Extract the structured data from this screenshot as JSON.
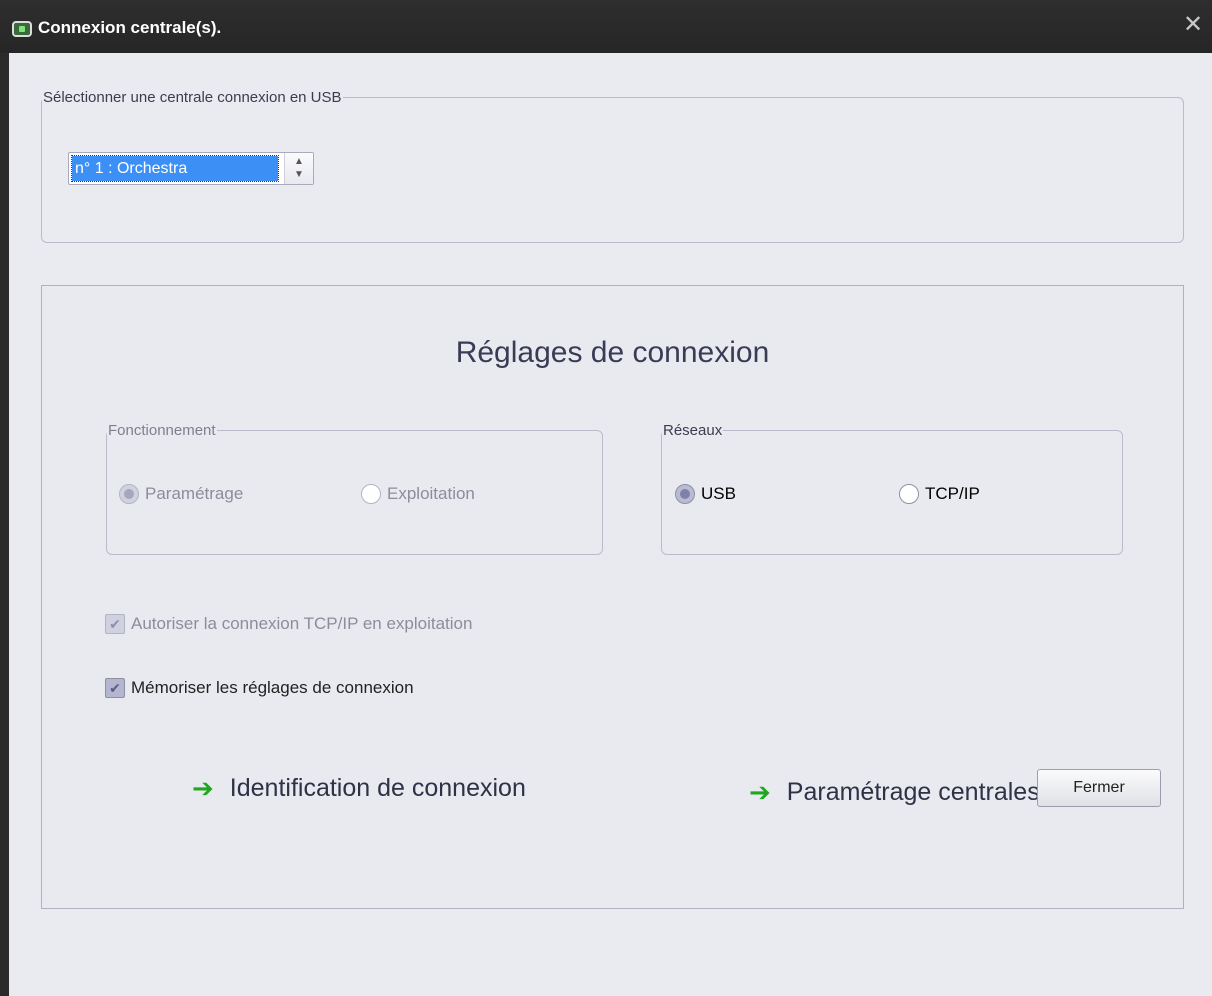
{
  "window": {
    "title": "Connexion centrale(s).",
    "close_glyph": "✕"
  },
  "usb_group": {
    "legend": "Sélectionner une centrale connexion en USB",
    "selected_value": "n° 1 : Orchestra",
    "arrows_glyph": "▲▼"
  },
  "settings": {
    "title": "Réglages de connexion",
    "fonctionnement": {
      "legend": "Fonctionnement",
      "options": [
        {
          "label": "Paramétrage",
          "selected": true,
          "disabled": true
        },
        {
          "label": "Exploitation",
          "selected": false,
          "disabled": true
        }
      ]
    },
    "reseaux": {
      "legend": "Réseaux",
      "options": [
        {
          "label": "USB",
          "selected": true
        },
        {
          "label": "TCP/IP",
          "selected": false
        }
      ]
    },
    "allow_tcp": {
      "label": "Autoriser la connexion TCP/IP en exploitation",
      "checked": true,
      "disabled": true
    },
    "remember": {
      "label": "Mémoriser les réglages de connexion",
      "checked": true
    },
    "links": {
      "identification": "Identification de connexion",
      "parametrage": "Paramétrage centrales",
      "arrow_glyph": "➔",
      "arrow_color": "#1fa81f"
    }
  },
  "footer": {
    "close_label": "Fermer"
  },
  "colors": {
    "titlebar": "#2b2b2b",
    "client_bg": "#eaebf0",
    "selection": "#3b8ff5"
  }
}
